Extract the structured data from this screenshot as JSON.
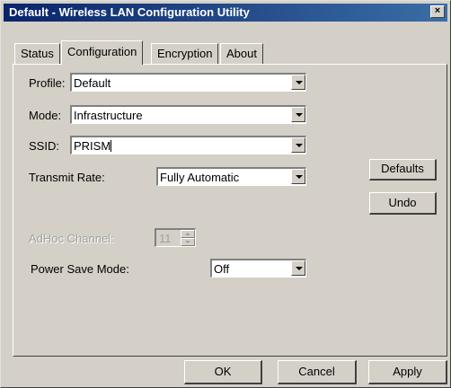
{
  "window": {
    "title": "Default - Wireless LAN Configuration Utility",
    "close_glyph": "×"
  },
  "tabs": [
    {
      "label": "Status",
      "active": false
    },
    {
      "label": "Configuration",
      "active": true
    },
    {
      "label": "Encryption",
      "active": false
    },
    {
      "label": "About",
      "active": false
    }
  ],
  "form": {
    "profile": {
      "label": "Profile:",
      "value": "Default"
    },
    "mode": {
      "label": "Mode:",
      "value": "Infrastructure"
    },
    "ssid": {
      "label": "SSID:",
      "value": "PRISM"
    },
    "transmit_rate": {
      "label": "Transmit Rate:",
      "value": "Fully Automatic"
    },
    "adhoc_channel": {
      "label": "AdHoc Channel:",
      "value": "11"
    },
    "power_save": {
      "label": "Power Save Mode:",
      "value": "Off"
    }
  },
  "buttons": {
    "defaults": "Defaults",
    "undo": "Undo",
    "ok": "OK",
    "cancel": "Cancel",
    "apply": "Apply"
  }
}
